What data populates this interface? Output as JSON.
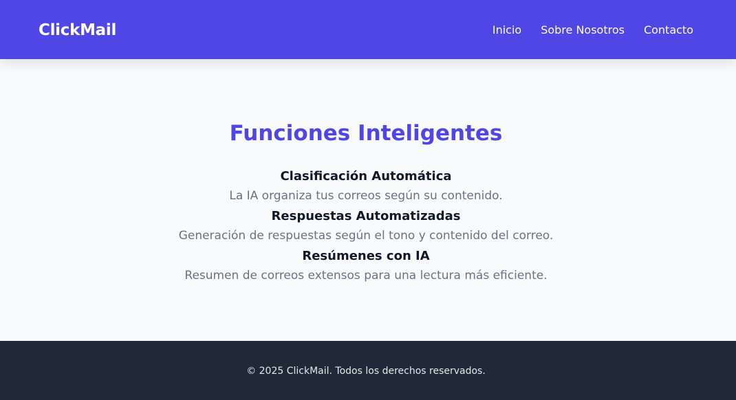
{
  "header": {
    "brand": "ClickMail",
    "nav": [
      "Inicio",
      "Sobre Nosotros",
      "Contacto"
    ]
  },
  "main": {
    "title": "Funciones Inteligentes",
    "features": [
      {
        "title": "Clasificación Automática",
        "desc": "La IA organiza tus correos según su contenido."
      },
      {
        "title": "Respuestas Automatizadas",
        "desc": "Generación de respuestas según el tono y contenido del correo."
      },
      {
        "title": "Resúmenes con IA",
        "desc": "Resumen de correos extensos para una lectura más eficiente."
      }
    ]
  },
  "footer": {
    "text": "© 2025 ClickMail. Todos los derechos reservados."
  },
  "colors": {
    "brand": "#4f46e5",
    "footer_bg": "#1f2937",
    "page_bg": "#f8fafc"
  }
}
